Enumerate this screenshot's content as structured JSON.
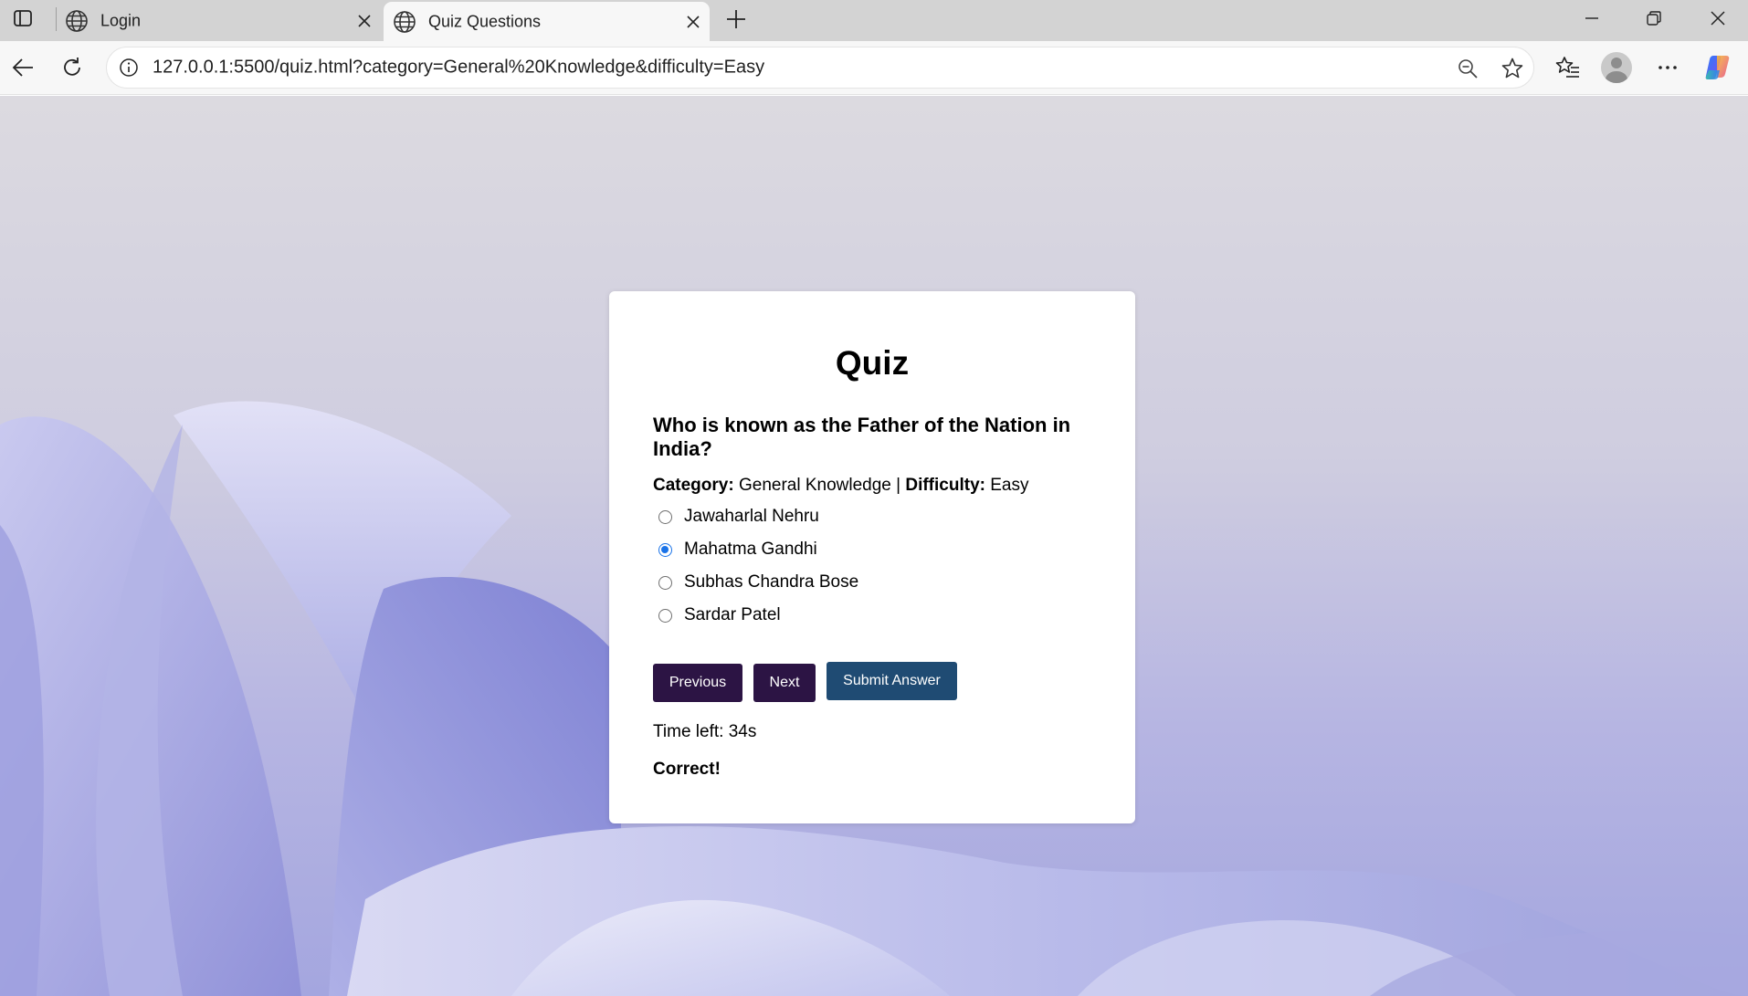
{
  "browser": {
    "tabs": [
      {
        "title": "Login",
        "active": false
      },
      {
        "title": "Quiz Questions",
        "active": true
      }
    ],
    "address_bar": {
      "url": "127.0.0.1:5500/quiz.html?category=General%20Knowledge&difficulty=Easy"
    },
    "icons": {
      "tab_actions": "tab-actions-icon",
      "favicon": "globe-icon",
      "close": "close-icon",
      "new_tab": "plus-icon",
      "back": "arrow-left-icon",
      "reload": "reload-icon",
      "site_info": "info-icon",
      "zoom": "zoom-out-icon",
      "favorite": "star-icon",
      "favorites": "favorites-icon",
      "profile": "avatar",
      "more": "more-icon",
      "copilot": "copilot-icon"
    }
  },
  "quiz": {
    "title": "Quiz",
    "question": "Who is known as the Father of the Nation in India?",
    "category_label": "Category:",
    "category_value": "General Knowledge",
    "separator": "|",
    "difficulty_label": "Difficulty:",
    "difficulty_value": "Easy",
    "options": [
      {
        "label": "Jawaharlal Nehru",
        "selected": false
      },
      {
        "label": "Mahatma Gandhi",
        "selected": true
      },
      {
        "label": "Subhas Chandra Bose",
        "selected": false
      },
      {
        "label": "Sardar Patel",
        "selected": false
      }
    ],
    "buttons": {
      "previous": "Previous",
      "next": "Next",
      "submit": "Submit Answer"
    },
    "timer_text": "Time left: 34s",
    "feedback": "Correct!"
  },
  "colors": {
    "nav_button": "#2c1444",
    "submit_button": "#1f4b73",
    "radio_selected": "#1a73e8",
    "card_background": "#ffffff"
  }
}
